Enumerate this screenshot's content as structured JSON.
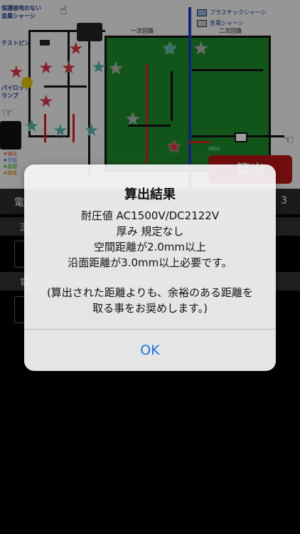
{
  "diagram": {
    "label_protected_chassis": "保護接地のない\n金属シャーシ",
    "label_test_pin": "テストピン",
    "label_pilot_lamp": "パイロット\nランプ",
    "legend_plastic": "プラスチックシャーシ",
    "legend_metal": "金属シャーシ",
    "region_primary": "一次回路",
    "region_secondary": "二次回路",
    "selv": "SELV",
    "calc_button": "算出",
    "legend_items": [
      "★強化",
      "★付加",
      "★基礎",
      "★機能"
    ],
    "colors": {
      "green_board": "#1e8a2b",
      "red_star": "#d9333f",
      "teal_star": "#4fb5a6",
      "blue_line": "#1d3bd1",
      "calc_red": "#b81616"
    }
  },
  "background": {
    "tab_partial_left": "電",
    "tab_partial_right": "3",
    "row_label_1": "深",
    "row_label_2": "電"
  },
  "alert": {
    "title": "算出結果",
    "line1": "耐圧値 AC1500V/DC2122V",
    "line2": "厚み 規定なし",
    "line3": "空間距離が2.0mm以上",
    "line4": "沿面距離が3.0mm以上必要です。",
    "line5": "(算出された距離よりも、余裕のある距離を",
    "line6": "取る事をお奨めします。)",
    "ok_label": "OK",
    "accent_color": "#1a73e8"
  }
}
